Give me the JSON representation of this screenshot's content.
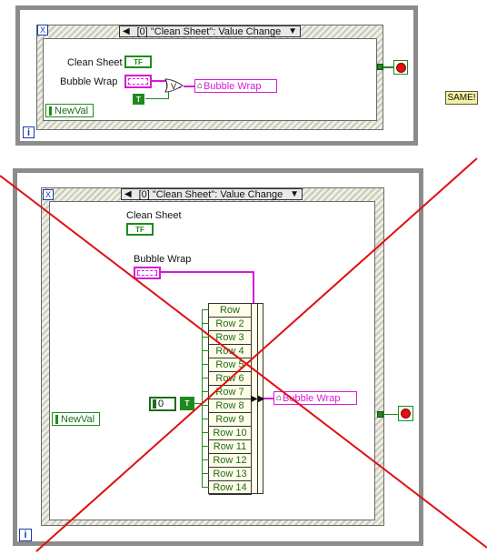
{
  "top_diagram": {
    "event_case": "[0] \"Clean Sheet\": Value Change",
    "clean_sheet_label": "Clean Sheet",
    "bubble_wrap_label": "Bubble Wrap",
    "bool_glyph": "TF",
    "true_const": "T",
    "or_symbol": "V",
    "bundle_out": "Bubble Wrap",
    "newval": "NewVal",
    "iter": "i",
    "x_icon": "X"
  },
  "same_note": "SAME!",
  "bottom_diagram": {
    "event_case": "[0] \"Clean Sheet\": Value Change",
    "clean_sheet_label": "Clean Sheet",
    "bubble_wrap_label": "Bubble Wrap",
    "bool_glyph": "TF",
    "numeric_value": "0",
    "true_const": "T",
    "bundle_out": "Bubble Wrap",
    "newval": "NewVal",
    "iter": "i",
    "x_icon": "X",
    "rows": [
      "Row",
      "Row 2",
      "Row 3",
      "Row 4",
      "Row 5",
      "Row 6",
      "Row 7",
      "Row 8",
      "Row 9",
      "Row 10",
      "Row 11",
      "Row 12",
      "Row 13",
      "Row 14"
    ]
  },
  "colors": {
    "boolean": "#1e8a1e",
    "cluster": "#d61ad6",
    "cross": "#e01010",
    "loop": "#8c8c8c"
  }
}
